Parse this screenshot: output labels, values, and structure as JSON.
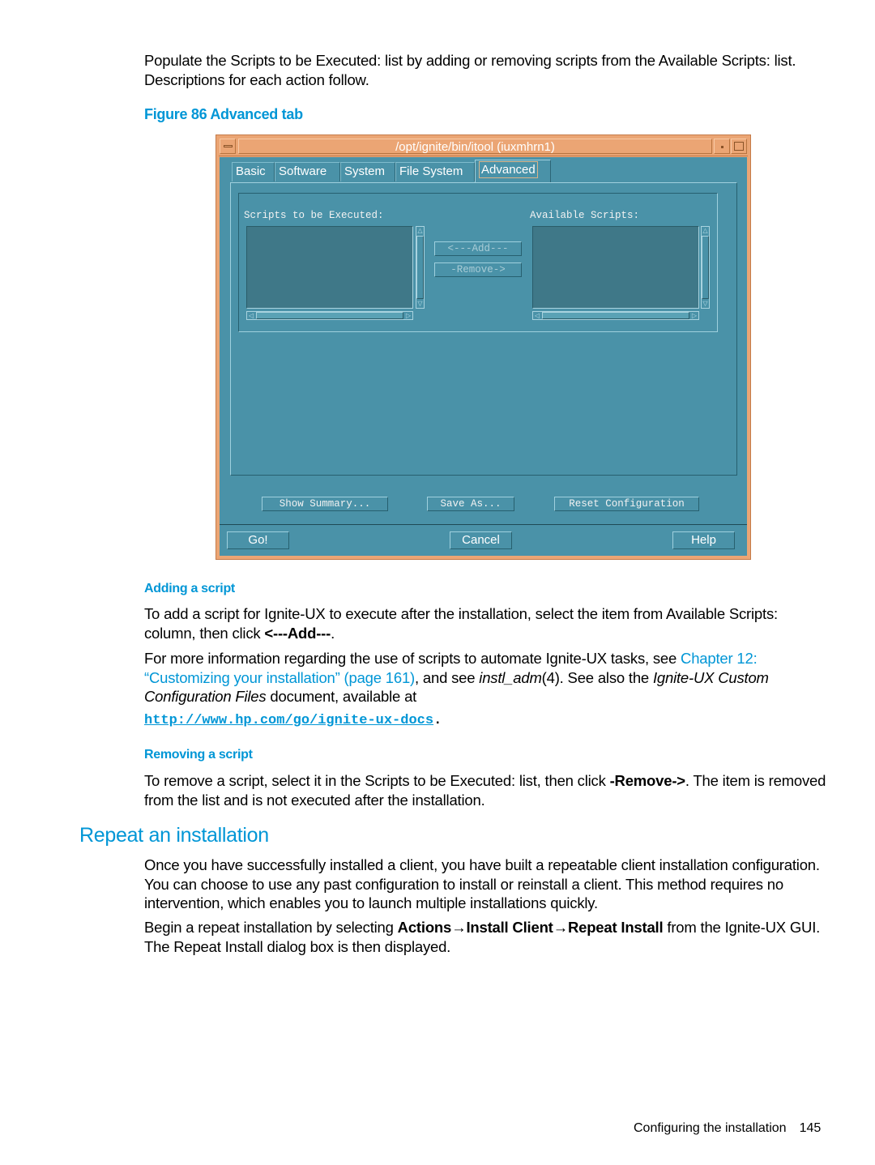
{
  "intro": {
    "text": "Populate the Scripts to be Executed: list by adding or removing scripts from the Available Scripts: list. Descriptions for each action follow."
  },
  "figure": {
    "caption": "Figure 86 Advanced tab",
    "window": {
      "title": "/opt/ignite/bin/itool (iuxmhrn1)",
      "tabs": [
        {
          "label": "Basic",
          "active": false
        },
        {
          "label": "Software",
          "active": false
        },
        {
          "label": "System",
          "active": false
        },
        {
          "label": "File System",
          "active": false
        },
        {
          "label": "Advanced",
          "active": true
        }
      ],
      "scripts_to_execute_label": "Scripts to be Executed:",
      "available_scripts_label": "Available Scripts:",
      "scripts_to_execute_items": [],
      "available_scripts_items": [],
      "add_button": "<---Add---",
      "remove_button": "-Remove->",
      "show_summary_button": "Show Summary...",
      "save_as_button": "Save As...",
      "reset_button": "Reset Configuration",
      "go_button": "Go!",
      "cancel_button": "Cancel",
      "help_button": "Help"
    }
  },
  "adding": {
    "heading": "Adding a script",
    "p1_before": "To add a script for Ignite-UX to execute after the installation, select the item from Available Scripts: column, then click ",
    "p1_bold": "<---Add---",
    "p1_after": ".",
    "p2_before": "For more information regarding the use of scripts to automate Ignite-UX tasks, see ",
    "p2_link": "Chapter 12: “Customizing your installation” (page 161)",
    "p2_mid": ", and see ",
    "p2_italic1": "instl_adm",
    "p2_mid2": "(4). See also the ",
    "p2_italic2": "Ignite-UX Custom Configuration Files",
    "p2_after": " document, available at",
    "url": "http://www.hp.com/go/ignite-ux-docs",
    "url_after": "."
  },
  "removing": {
    "heading": "Removing a script",
    "p_before": "To remove a script, select it in the Scripts to be Executed: list, then click ",
    "p_bold": "-Remove->",
    "p_after": ". The item is removed from the list and is not executed after the installation."
  },
  "repeat": {
    "heading": "Repeat an installation",
    "p1": "Once you have successfully installed a client, you have built a repeatable client installation configuration. You can choose to use any past configuration to install or reinstall a client. This method requires no intervention, which enables you to launch multiple installations quickly.",
    "p2_before": "Begin a repeat installation by selecting ",
    "p2_b1": "Actions",
    "arrow": "→",
    "p2_b2": "Install Client",
    "p2_b3": "Repeat Install",
    "p2_after": " from the Ignite-UX GUI. The Repeat Install dialog box is then displayed."
  },
  "footer": {
    "section": "Configuring the installation",
    "page": "145"
  }
}
